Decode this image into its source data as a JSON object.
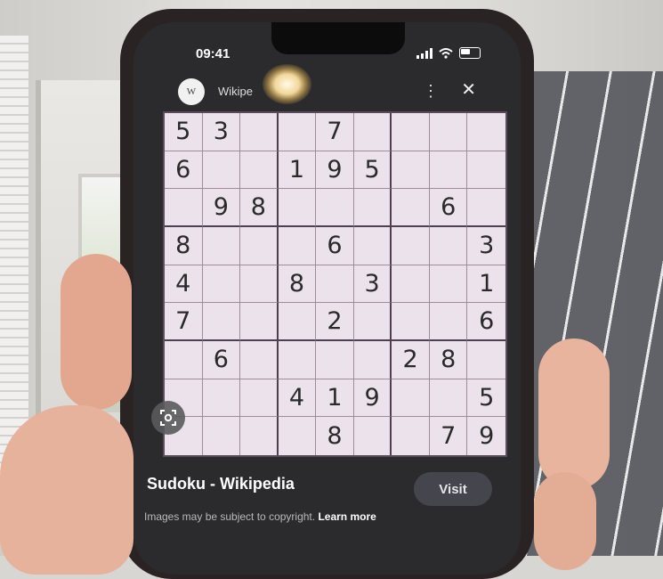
{
  "status_bar": {
    "time": "09:41"
  },
  "site": {
    "favicon_letter": "W",
    "name": "Wikipe"
  },
  "sudoku": {
    "rows": [
      [
        "5",
        "3",
        "",
        "",
        "7",
        "",
        "",
        "",
        ""
      ],
      [
        "6",
        "",
        "",
        "1",
        "9",
        "5",
        "",
        "",
        ""
      ],
      [
        "",
        "9",
        "8",
        "",
        "",
        "",
        "",
        "6",
        ""
      ],
      [
        "8",
        "",
        "",
        "",
        "6",
        "",
        "",
        "",
        "3"
      ],
      [
        "4",
        "",
        "",
        "8",
        "",
        "3",
        "",
        "",
        "1"
      ],
      [
        "7",
        "",
        "",
        "",
        "2",
        "",
        "",
        "",
        "6"
      ],
      [
        "",
        "6",
        "",
        "",
        "",
        "",
        "2",
        "8",
        ""
      ],
      [
        "",
        "",
        "",
        "4",
        "1",
        "9",
        "",
        "",
        "5"
      ],
      [
        "",
        "",
        "",
        "",
        "8",
        "",
        "",
        "7",
        "9"
      ]
    ]
  },
  "result": {
    "title": "Sudoku - Wikipedia",
    "visit_label": "Visit",
    "copyright_notice": "Images may be subject to copyright.",
    "learn_more": "Learn more"
  },
  "icons": {
    "more": "more-vertical-icon",
    "close": "close-icon",
    "lens": "lens-icon"
  }
}
